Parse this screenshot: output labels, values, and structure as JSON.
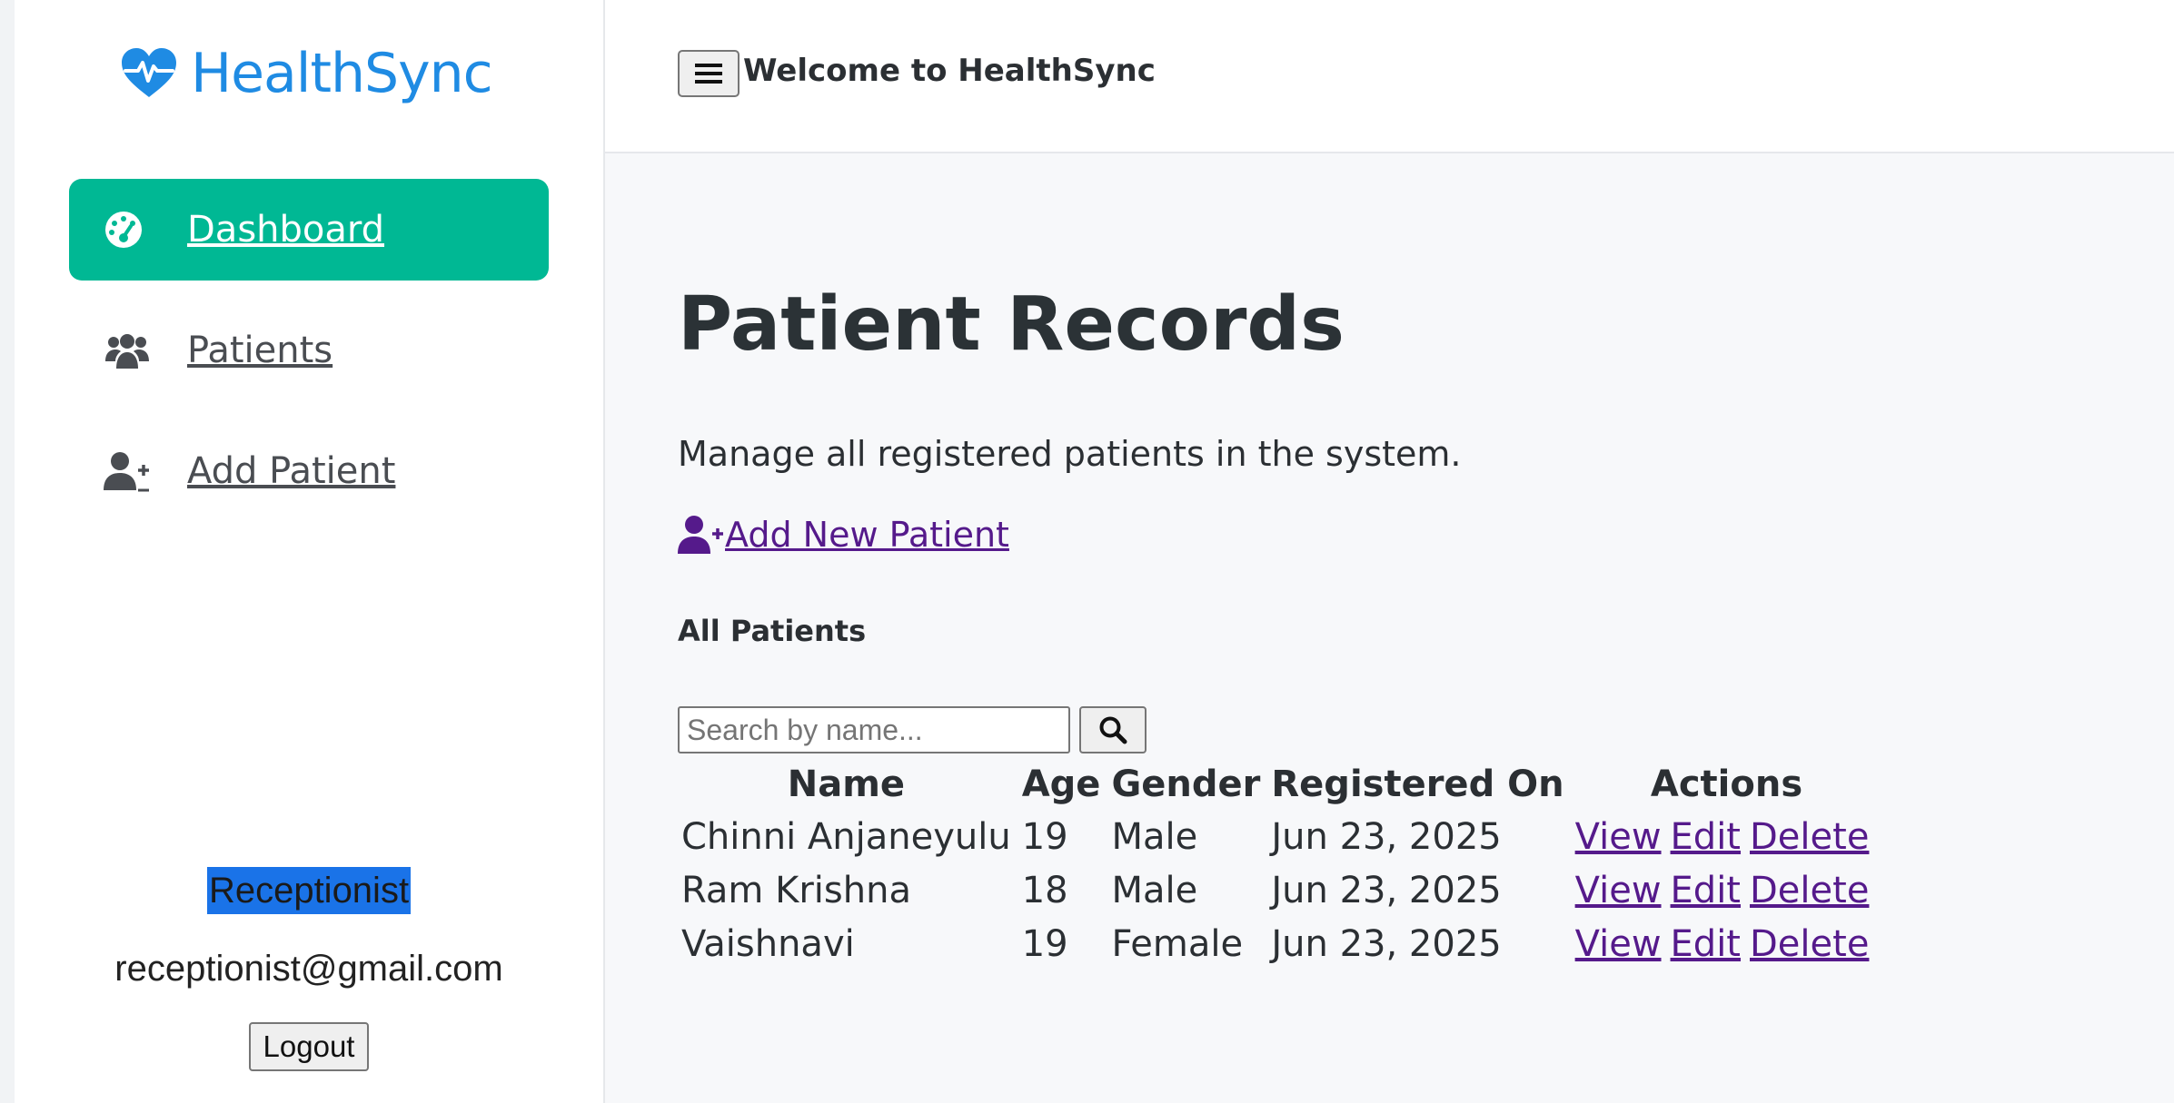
{
  "app": {
    "name": "HealthSync"
  },
  "sidebar": {
    "items": [
      {
        "label": "Dashboard",
        "icon": "dashboard-gauge-icon",
        "active": true
      },
      {
        "label": "Patients",
        "icon": "users-icon",
        "active": false
      },
      {
        "label": "Add Patient",
        "icon": "user-plus-icon",
        "active": false
      }
    ],
    "user": {
      "role": "Receptionist",
      "email": "receptionist@gmail.com",
      "logout_label": "Logout"
    }
  },
  "header": {
    "title": "Welcome to HealthSync",
    "menu_icon": "hamburger-menu-icon"
  },
  "main": {
    "title": "Patient Records",
    "subtitle": "Manage all registered patients in the system.",
    "add_link_label": " Add New Patient",
    "section_title": "All Patients",
    "search": {
      "placeholder": "Search by name...",
      "value": "",
      "icon": "search-icon"
    },
    "table": {
      "columns": [
        "Name",
        "Age",
        "Gender",
        "Registered On",
        "Actions"
      ],
      "rows": [
        {
          "name": "Chinni Anjaneyulu",
          "age": "19",
          "gender": "Male",
          "registered": "Jun 23, 2025"
        },
        {
          "name": "Ram Krishna",
          "age": "18",
          "gender": "Male",
          "registered": "Jun 23, 2025"
        },
        {
          "name": "Vaishnavi",
          "age": "19",
          "gender": "Female",
          "registered": "Jun 23, 2025"
        }
      ],
      "actions": [
        "View",
        "Edit",
        "Delete"
      ]
    }
  },
  "colors": {
    "brand": "#1f8be3",
    "active_nav": "#00b894",
    "link": "#551a8b",
    "role_highlight": "#1a73e8"
  }
}
